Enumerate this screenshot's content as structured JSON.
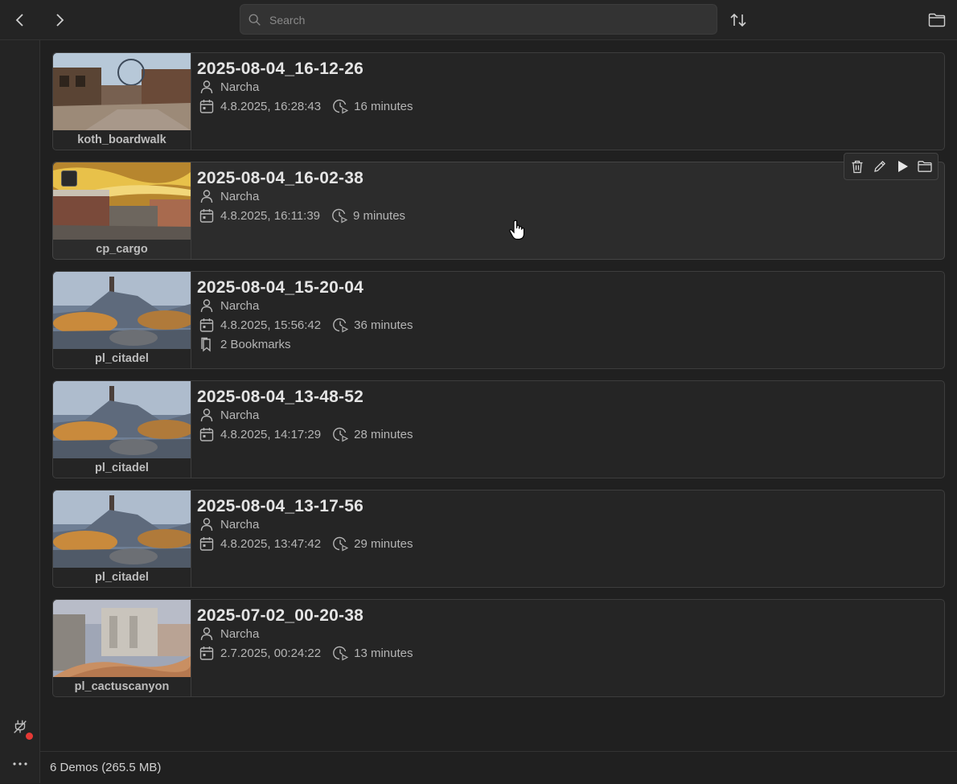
{
  "search": {
    "placeholder": "Search"
  },
  "demos": [
    {
      "title": "2025-08-04_16-12-26",
      "map": "koth_boardwalk",
      "user": "Narcha",
      "date": "4.8.2025, 16:28:43",
      "duration": "16 minutes",
      "bookmarks": ""
    },
    {
      "title": "2025-08-04_16-02-38",
      "map": "cp_cargo",
      "user": "Narcha",
      "date": "4.8.2025, 16:11:39",
      "duration": "9 minutes",
      "bookmarks": ""
    },
    {
      "title": "2025-08-04_15-20-04",
      "map": "pl_citadel",
      "user": "Narcha",
      "date": "4.8.2025, 15:56:42",
      "duration": "36 minutes",
      "bookmarks": "2 Bookmarks"
    },
    {
      "title": "2025-08-04_13-48-52",
      "map": "pl_citadel",
      "user": "Narcha",
      "date": "4.8.2025, 14:17:29",
      "duration": "28 minutes",
      "bookmarks": ""
    },
    {
      "title": "2025-08-04_13-17-56",
      "map": "pl_citadel",
      "user": "Narcha",
      "date": "4.8.2025, 13:47:42",
      "duration": "29 minutes",
      "bookmarks": ""
    },
    {
      "title": "2025-07-02_00-20-38",
      "map": "pl_cactuscanyon",
      "user": "Narcha",
      "date": "2.7.2025, 00:24:22",
      "duration": "13 minutes",
      "bookmarks": ""
    }
  ],
  "status": {
    "summary": "6 Demos (265.5 MB)"
  },
  "icons": {
    "back": "chevron-left-icon",
    "forward": "chevron-right-icon",
    "search": "search-icon",
    "sort": "sort-icon",
    "folder": "folder-icon",
    "user": "user-icon",
    "calendar": "calendar-icon",
    "duration": "clock-play-icon",
    "bookmark": "bookmark-icon",
    "delete": "trash-icon",
    "edit": "pencil-icon",
    "play": "play-icon",
    "connection": "plug-icon",
    "more": "more-icon"
  },
  "colors": {
    "background": "#202020",
    "card": "#252525",
    "status_dot": "#e53935"
  }
}
